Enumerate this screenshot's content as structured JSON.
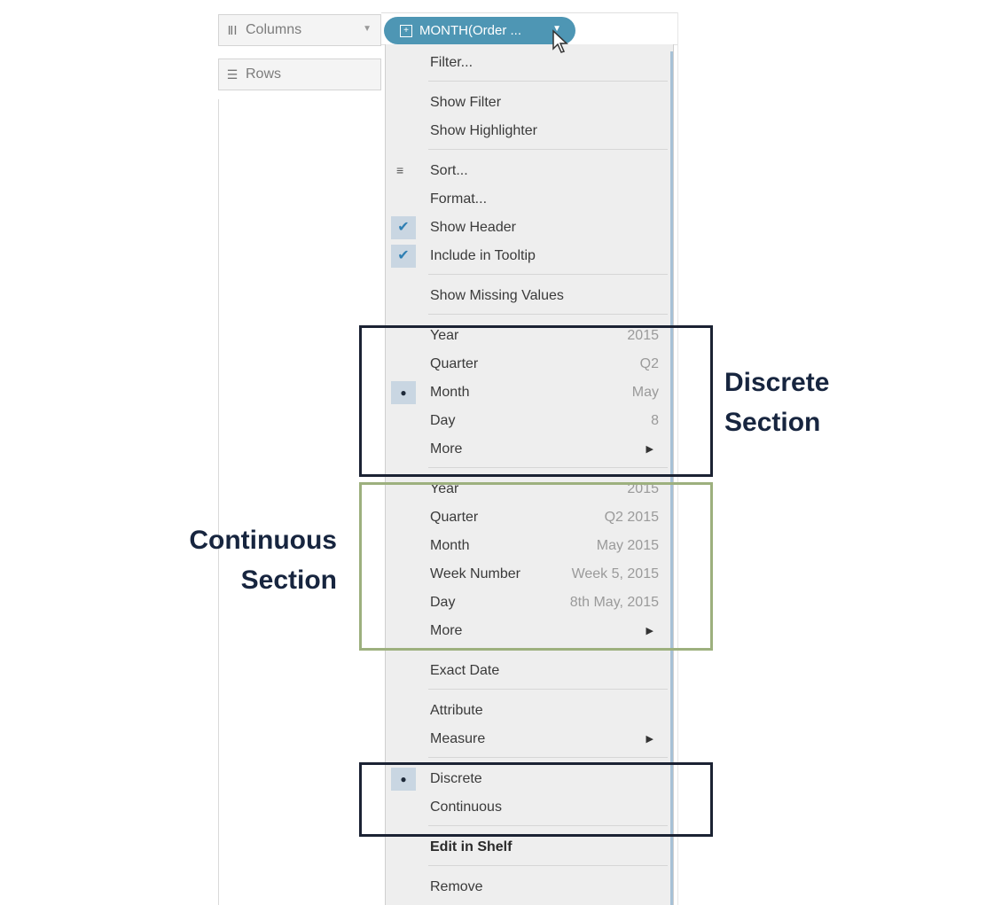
{
  "shelves": {
    "columns_label": "Columns",
    "rows_label": "Rows",
    "pill_label": "MONTH(Order ..."
  },
  "menu": {
    "filter": "Filter...",
    "show_filter": "Show Filter",
    "show_highlighter": "Show Highlighter",
    "sort": "Sort...",
    "format": "Format...",
    "show_header": "Show Header",
    "include_tooltip": "Include in Tooltip",
    "show_missing": "Show Missing Values",
    "discrete_items": [
      {
        "label": "Year",
        "value": "2015"
      },
      {
        "label": "Quarter",
        "value": "Q2"
      },
      {
        "label": "Month",
        "value": "May"
      },
      {
        "label": "Day",
        "value": "8"
      },
      {
        "label": "More",
        "value": ""
      }
    ],
    "continuous_items": [
      {
        "label": "Year",
        "value": "2015"
      },
      {
        "label": "Quarter",
        "value": "Q2 2015"
      },
      {
        "label": "Month",
        "value": "May 2015"
      },
      {
        "label": "Week Number",
        "value": "Week 5, 2015"
      },
      {
        "label": "Day",
        "value": "8th May, 2015"
      },
      {
        "label": "More",
        "value": ""
      }
    ],
    "exact_date": "Exact Date",
    "attribute": "Attribute",
    "measure": "Measure",
    "discrete": "Discrete",
    "continuous": "Continuous",
    "edit_in_shelf": "Edit in Shelf",
    "remove": "Remove"
  },
  "annotations": {
    "discrete_line1": "Discrete",
    "discrete_line2": "Section",
    "continuous_line1": "Continuous",
    "continuous_line2": "Section"
  },
  "colors": {
    "pill": "#4e96b4",
    "discrete_box": "#1b2233",
    "continuous_box": "#9db07e",
    "annotation_text": "#17253f"
  },
  "icons": {
    "columns": "columns-icon",
    "rows": "rows-icon",
    "check": "check-icon",
    "radio": "radio-dot-icon",
    "submenu": "submenu-arrow-icon"
  }
}
